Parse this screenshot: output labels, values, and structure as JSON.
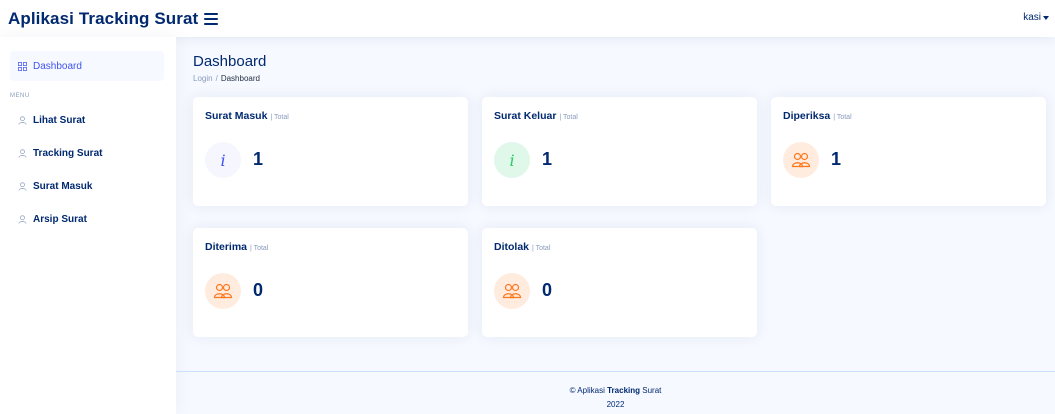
{
  "header": {
    "brand": "Aplikasi Tracking Surat",
    "user": "kasi"
  },
  "sidebar": {
    "items": [
      {
        "label": "Dashboard",
        "icon": "grid-icon"
      },
      {
        "label": "Lihat Surat",
        "icon": "person-icon"
      },
      {
        "label": "Tracking Surat",
        "icon": "person-icon"
      },
      {
        "label": "Surat Masuk",
        "icon": "person-icon"
      },
      {
        "label": "Arsip Surat",
        "icon": "person-icon"
      }
    ],
    "heading": "MENU"
  },
  "page": {
    "title": "Dashboard",
    "breadcrumb": [
      "Login",
      "Dashboard"
    ]
  },
  "cards": [
    {
      "title": "Surat Masuk",
      "subtitle": "| Total",
      "value": "1",
      "icon": "info-icon",
      "icon_bg": "#f6f6fe",
      "icon_color": "#4154f1"
    },
    {
      "title": "Surat Keluar",
      "subtitle": "| Total",
      "value": "1",
      "icon": "info-icon",
      "icon_bg": "#e0f8e9",
      "icon_color": "#2eca6a"
    },
    {
      "title": "Diperiksa",
      "subtitle": "| Total",
      "value": "1",
      "icon": "people-icon",
      "icon_bg": "#ffecdf",
      "icon_color": "#ff771d"
    },
    {
      "title": "Diterima",
      "subtitle": "| Total",
      "value": "0",
      "icon": "people-icon",
      "icon_bg": "#ffecdf",
      "icon_color": "#ff771d"
    },
    {
      "title": "Ditolak",
      "subtitle": "| Total",
      "value": "0",
      "icon": "people-icon",
      "icon_bg": "#ffecdf",
      "icon_color": "#ff771d"
    }
  ],
  "footer": {
    "copyright": "©",
    "brand_prefix": "Aplikasi",
    "brand_bold": "Tracking",
    "brand_suffix": "Surat",
    "year": "2022"
  },
  "colors": {
    "accent": "#4154f1",
    "navy": "#012970",
    "muted": "#899bbd",
    "background": "#f6f9ff"
  }
}
